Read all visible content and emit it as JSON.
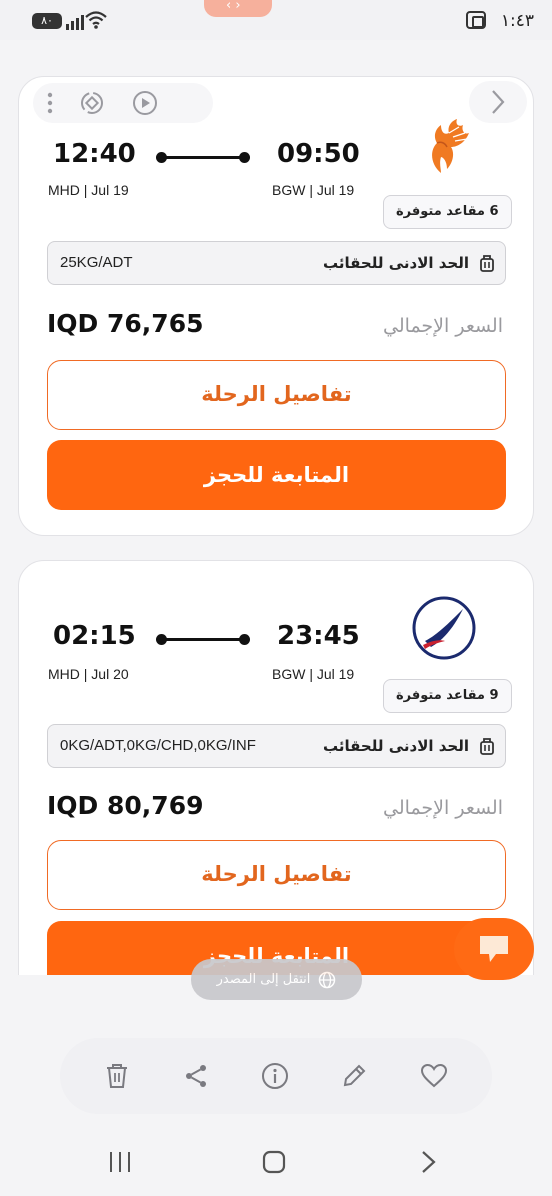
{
  "status_bar": {
    "time": "١:٤٣",
    "battery": "٨٠"
  },
  "flights": [
    {
      "departure_time": "12:40",
      "arrival_time": "09:50",
      "departure_info": "MHD | Jul 19",
      "arrival_info": "BGW | Jul 19",
      "seats_available": "6 مقاعد متوفرة",
      "baggage_label": "الحد الادنى للحقائب",
      "baggage_value": "25KG/ADT",
      "price": "IQD 76,765",
      "total_label": "السعر الإجمالي",
      "details_button": "تفاصيل الرحلة",
      "book_button": "المتابعة للحجز",
      "airline_logo": "phoenix-logo"
    },
    {
      "departure_time": "02:15",
      "arrival_time": "23:45",
      "departure_info": "MHD | Jul 20",
      "arrival_info": "BGW | Jul 19",
      "seats_available": "9 مقاعد متوفرة",
      "baggage_label": "الحد الادنى للحقائب",
      "baggage_value": "0KG/ADT,0KG/CHD,0KG/INF",
      "price": "IQD 80,769",
      "total_label": "السعر الإجمالي",
      "details_button": "تفاصيل الرحلة",
      "book_button": "المتابعة للحجز",
      "airline_logo": "swoosh-logo"
    }
  ],
  "overlay": {
    "source_label": "انتقل إلى المصدر"
  },
  "colors": {
    "accent": "#ff6610",
    "accent_text": "#e2661e"
  },
  "bottom_actions": [
    "delete-icon",
    "share-icon",
    "info-icon",
    "edit-icon",
    "favorite-icon"
  ],
  "nav": [
    "recent-apps-icon",
    "home-icon",
    "back-icon"
  ]
}
